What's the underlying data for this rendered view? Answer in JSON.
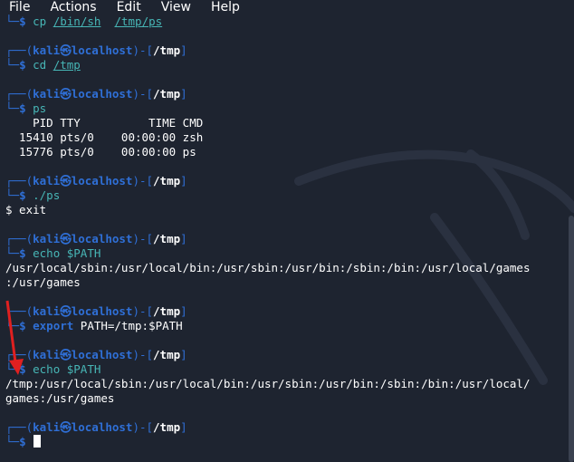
{
  "menubar": {
    "items": [
      "File",
      "Actions",
      "Edit",
      "View",
      "Help"
    ]
  },
  "terminal": {
    "lines": [
      {
        "t": "prompt2",
        "cmd": "cp",
        "args": [
          {
            "text": "/bin/sh",
            "u": true
          },
          {
            "text": " "
          },
          {
            "text": "/tmp/ps",
            "u": true
          }
        ]
      },
      {
        "t": "blank"
      },
      {
        "t": "prompt1",
        "user": "kali㉿localhost",
        "cwd": "/tmp"
      },
      {
        "t": "prompt2",
        "cmd": "cd",
        "args": [
          {
            "text": "/tmp",
            "u": true
          }
        ]
      },
      {
        "t": "blank"
      },
      {
        "t": "prompt1",
        "user": "kali㉿localhost",
        "cwd": "/tmp"
      },
      {
        "t": "prompt2",
        "cmd": "ps",
        "args": []
      },
      {
        "t": "out",
        "text": "    PID TTY          TIME CMD"
      },
      {
        "t": "out",
        "text": "  15410 pts/0    00:00:00 zsh"
      },
      {
        "t": "out",
        "text": "  15776 pts/0    00:00:00 ps"
      },
      {
        "t": "blank"
      },
      {
        "t": "prompt1",
        "user": "kali㉿localhost",
        "cwd": "/tmp"
      },
      {
        "t": "prompt2",
        "cmd": "./ps",
        "args": []
      },
      {
        "t": "out",
        "text": "$ exit"
      },
      {
        "t": "blank"
      },
      {
        "t": "prompt1",
        "user": "kali㉿localhost",
        "cwd": "/tmp"
      },
      {
        "t": "prompt2",
        "cmd": "echo",
        "args": [
          {
            "text": " $PATH",
            "plain": true
          }
        ]
      },
      {
        "t": "out",
        "text": "/usr/local/sbin:/usr/local/bin:/usr/sbin:/usr/bin:/sbin:/bin:/usr/local/games"
      },
      {
        "t": "out",
        "text": ":/usr/games"
      },
      {
        "t": "blank"
      },
      {
        "t": "prompt1",
        "user": "kali㉿localhost",
        "cwd": "/tmp"
      },
      {
        "t": "prompt2",
        "cmd": "export",
        "kw": true,
        "args": [
          {
            "text": " PATH=/tmp:$PATH",
            "plain": true
          }
        ]
      },
      {
        "t": "blank"
      },
      {
        "t": "prompt1",
        "user": "kali㉿localhost",
        "cwd": "/tmp"
      },
      {
        "t": "prompt2",
        "cmd": "echo",
        "args": [
          {
            "text": " $PATH",
            "plain": true
          }
        ]
      },
      {
        "t": "out",
        "text": "/tmp:/usr/local/sbin:/usr/local/bin:/usr/sbin:/usr/bin:/sbin:/bin:/usr/local/"
      },
      {
        "t": "out",
        "text": "games:/usr/games"
      },
      {
        "t": "blank"
      },
      {
        "t": "prompt1",
        "user": "kali㉿localhost",
        "cwd": "/tmp"
      },
      {
        "t": "prompt2",
        "cmd": "",
        "args": [],
        "cursor": true
      }
    ]
  },
  "colors": {
    "background": "#1e2430",
    "prompt_blue": "#2f6fd6",
    "command_cyan": "#47b6b6",
    "annotation_red": "#e02020"
  }
}
